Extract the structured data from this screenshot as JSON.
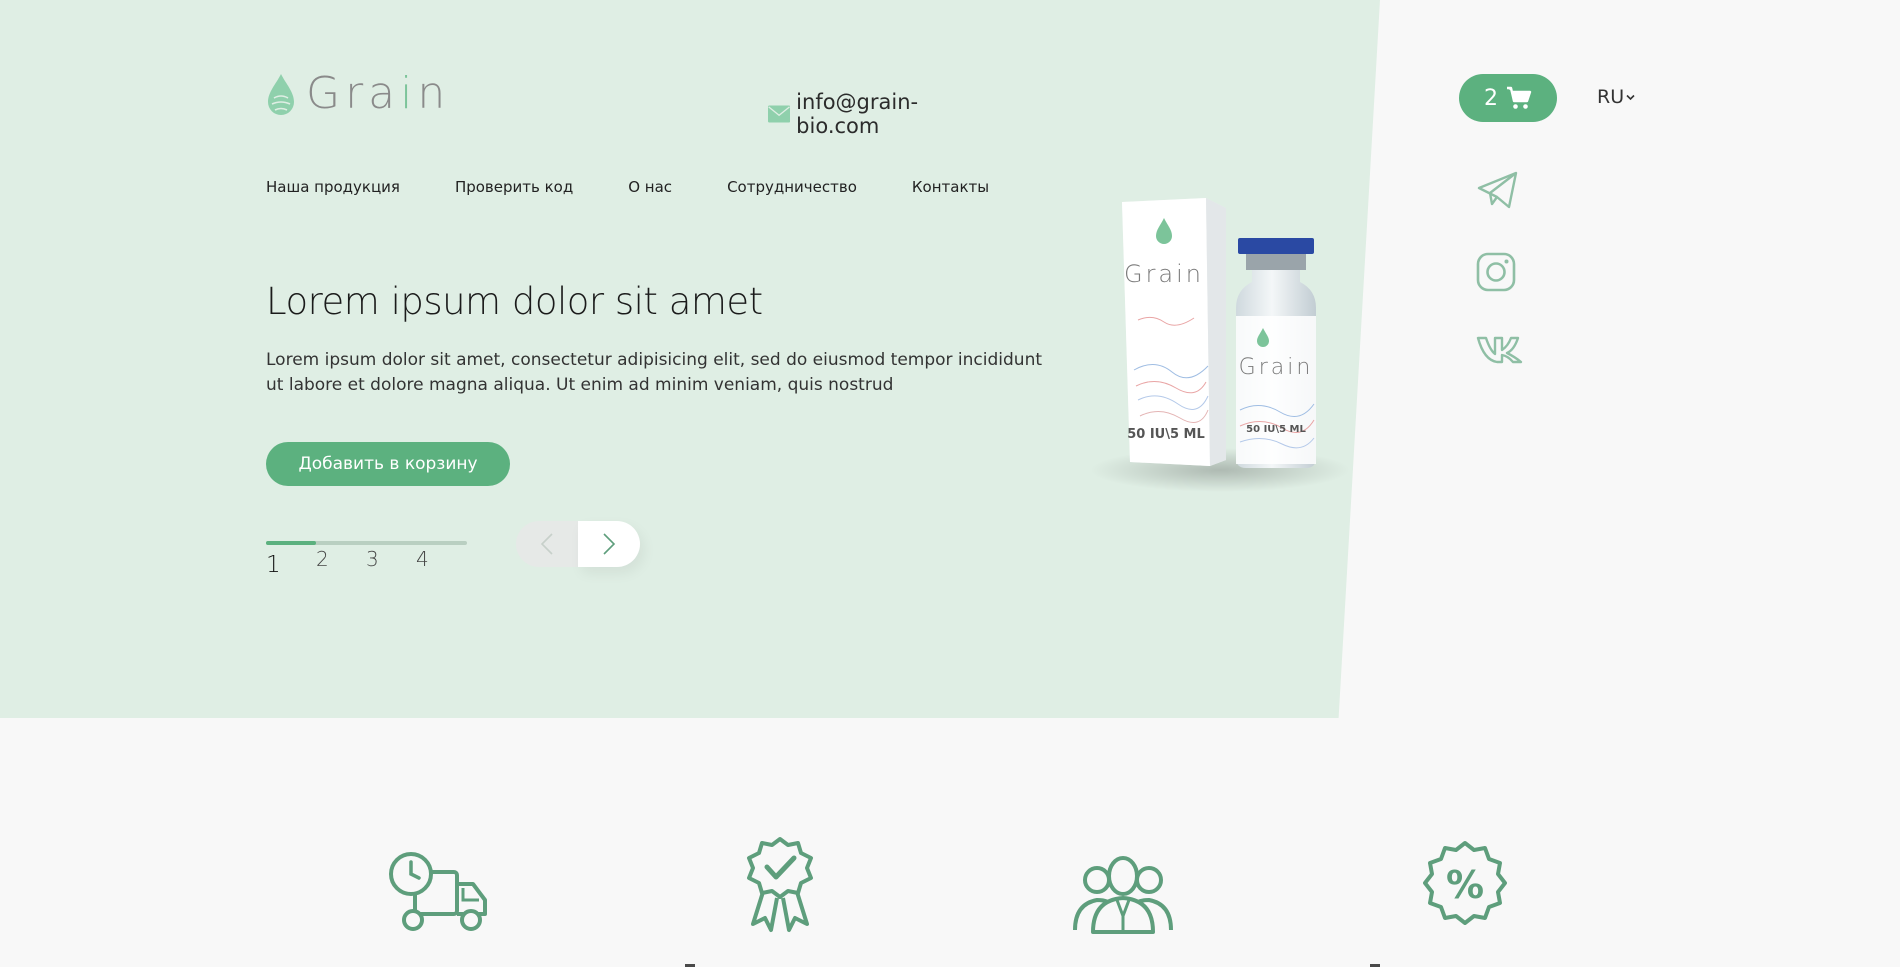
{
  "brand": {
    "name_main": "Gra",
    "name_accent": "i",
    "name_tail": "n"
  },
  "header": {
    "email": "info@grain-bio.com",
    "cart_count": "2",
    "language": "RU"
  },
  "nav": {
    "items": [
      {
        "label": "Наша продукция"
      },
      {
        "label": "Проверить код"
      },
      {
        "label": "О нас"
      },
      {
        "label": "Сотрудничество"
      },
      {
        "label": "Контакты"
      }
    ]
  },
  "hero": {
    "title": "Lorem ipsum dolor sit amet",
    "description": "Lorem ipsum dolor sit amet, consectetur adipisicing elit, sed do eiusmod tempor incididunt ut labore et dolore magna aliqua. Ut enim ad minim veniam, quis nostrud",
    "cta_label": "Добавить в корзину"
  },
  "slider": {
    "pages": [
      "1",
      "2",
      "3",
      "4"
    ],
    "current": 1,
    "progress": 0.25
  },
  "product": {
    "box_brand": "Grain",
    "vial_brand": "Grain",
    "box_dosage": "50 IU\\5 ML",
    "vial_dosage": "50 IU\\5 ML"
  },
  "social": [
    "telegram-icon",
    "instagram-icon",
    "vk-icon"
  ],
  "features": [
    "delivery-truck-icon",
    "quality-badge-icon",
    "team-icon",
    "discount-icon"
  ],
  "colors": {
    "accent": "#5cb17f",
    "hero_bg": "#dfeee4",
    "page_bg": "#f8f8f8",
    "icon_green": "#5e9e7c"
  }
}
